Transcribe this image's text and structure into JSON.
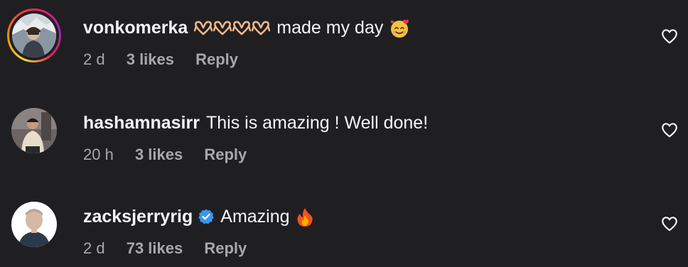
{
  "comments": [
    {
      "username": "vonkomerka",
      "text": "made my day",
      "emoji_before": "heart-hands-emoji x4",
      "emoji_after": "smiling-face-with-hearts-emoji",
      "time": "2 d",
      "likes": "3 likes",
      "reply": "Reply",
      "has_story_ring": true
    },
    {
      "username": "hashamnasirr",
      "text": "This is amazing ! Well done!",
      "time": "20 h",
      "likes": "3 likes",
      "reply": "Reply",
      "has_story_ring": false
    },
    {
      "username": "zacksjerryrig",
      "verified": true,
      "text": "Amazing",
      "emoji_after": "fire-emoji",
      "time": "2 d",
      "likes": "73 likes",
      "reply": "Reply",
      "has_story_ring": false
    }
  ],
  "colors": {
    "background": "#1f1f22",
    "text_primary": "#f5f5f5",
    "text_secondary": "#a8a8a8",
    "verified_badge": "#3897f0"
  }
}
